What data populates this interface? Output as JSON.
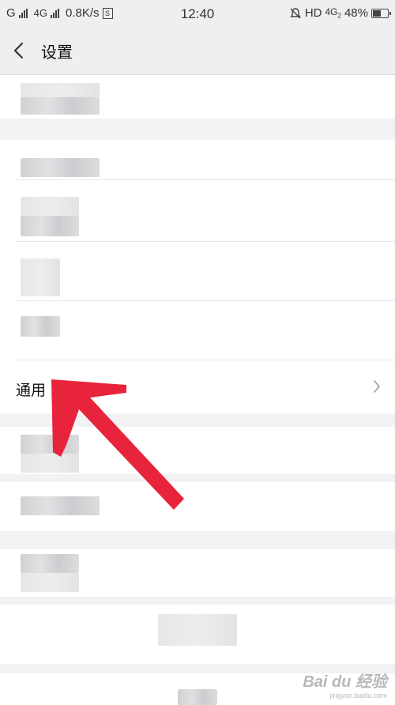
{
  "status_bar": {
    "carrier": "G",
    "network": "4G",
    "speed": "0.8K/s",
    "sim_icon": "S",
    "time": "12:40",
    "hd": "HD",
    "network_right": "4G",
    "network_right_sub": "2",
    "battery": "48%",
    "battery_level": 0.48
  },
  "nav": {
    "back_icon": "chevron-left",
    "title": "设置"
  },
  "settings": {
    "general_label": "通用"
  },
  "annotation": {
    "arrow_color": "#e8243c"
  },
  "watermark": {
    "text": "Bai du 经验",
    "sub": "jingyan.baidu.com"
  }
}
